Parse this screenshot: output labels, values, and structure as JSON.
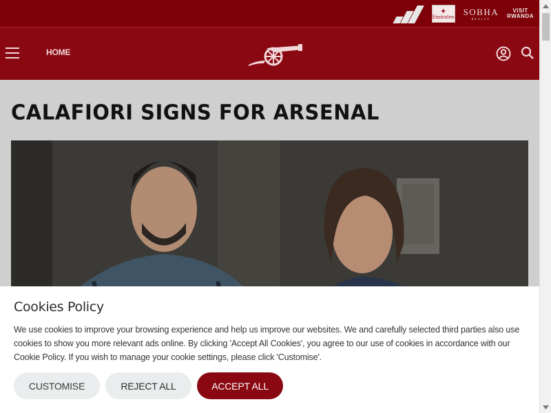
{
  "colors": {
    "brand_red": "#8a0812",
    "sponsor_bar": "#7e0008",
    "accept_button": "#8a0812",
    "secondary_button": "#eaedee"
  },
  "sponsors": {
    "adidas": "adidas-logo",
    "emirates_text": "Emirates",
    "sobha_text": "SOBHA",
    "sobha_sub": "REALTY",
    "rwanda_line1": "VISIT",
    "rwanda_line2": "RWANDA"
  },
  "nav": {
    "menu_icon": "hamburger-icon",
    "home_label": "HOME",
    "crest": "arsenal-cannon-logo",
    "account_icon": "user-icon",
    "search_icon": "search-icon"
  },
  "article": {
    "title": "CALAFIORI SIGNS FOR ARSENAL"
  },
  "cookies": {
    "title": "Cookies Policy",
    "body": "We use cookies to improve your browsing experience and help us improve our websites. We and carefully selected third parties also use cookies to show you more relevant ads online. By clicking 'Accept All Cookies', you agree to our use of cookies in accordance with our Cookie Policy. If you wish to manage your cookie settings, please click 'Customise'.",
    "customise_label": "CUSTOMISE",
    "reject_label": "REJECT ALL",
    "accept_label": "ACCEPT ALL"
  }
}
